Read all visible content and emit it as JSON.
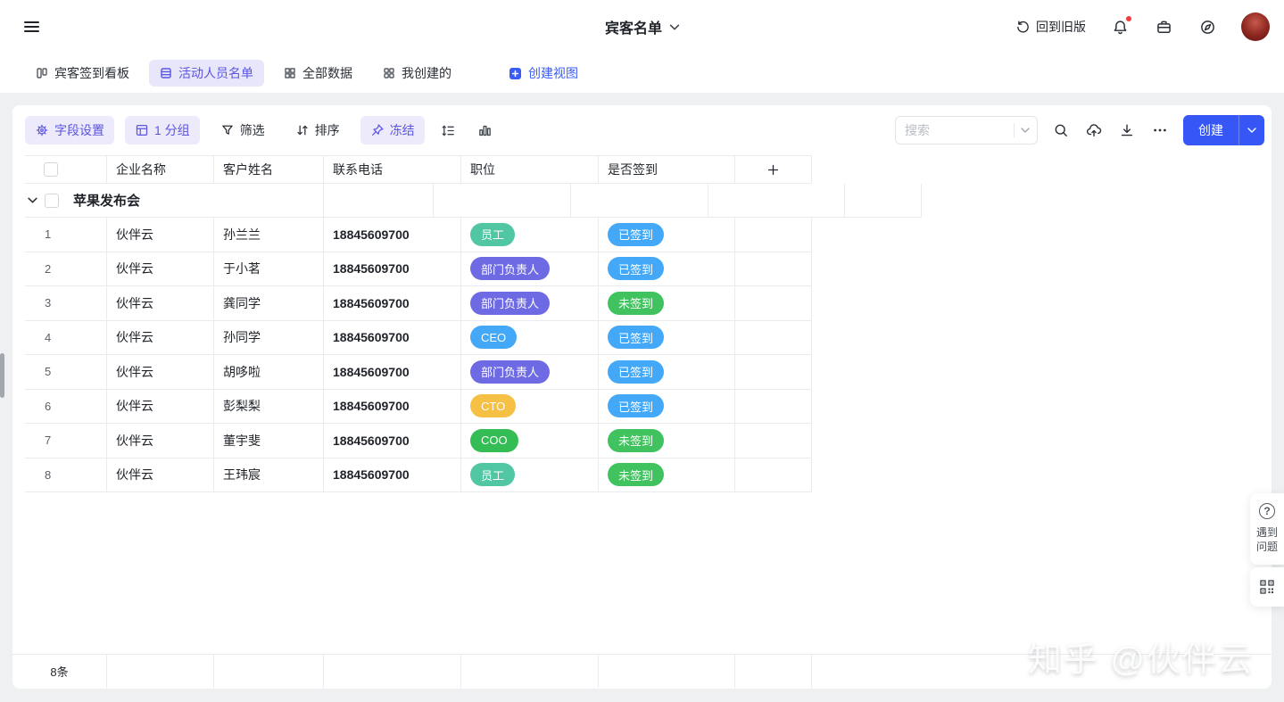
{
  "topbar": {
    "title": "宾客名单",
    "back_old": "回到旧版"
  },
  "tabs": {
    "items": [
      {
        "label": "宾客签到看板"
      },
      {
        "label": "活动人员名单"
      },
      {
        "label": "全部数据"
      },
      {
        "label": "我创建的"
      }
    ],
    "create_view": "创建视图"
  },
  "toolbar": {
    "field_settings": "字段设置",
    "group": "1 分组",
    "filter": "筛选",
    "sort": "排序",
    "freeze": "冻结",
    "search_placeholder": "搜索",
    "create": "创建"
  },
  "table": {
    "columns": [
      "企业名称",
      "客户姓名",
      "联系电话",
      "职位",
      "是否签到"
    ],
    "group_name": "苹果发布会",
    "rows": [
      {
        "num": "1",
        "company": "伙伴云",
        "name": "孙兰兰",
        "phone": "18845609700",
        "position": "员工",
        "position_color": "teal",
        "signin": "已签到",
        "signin_color": "blue"
      },
      {
        "num": "2",
        "company": "伙伴云",
        "name": "于小茗",
        "phone": "18845609700",
        "position": "部门负责人",
        "position_color": "purple",
        "signin": "已签到",
        "signin_color": "blue"
      },
      {
        "num": "3",
        "company": "伙伴云",
        "name": "龚同学",
        "phone": "18845609700",
        "position": "部门负责人",
        "position_color": "purple",
        "signin": "未签到",
        "signin_color": "green2"
      },
      {
        "num": "4",
        "company": "伙伴云",
        "name": "孙同学",
        "phone": "18845609700",
        "position": "CEO",
        "position_color": "blue",
        "signin": "已签到",
        "signin_color": "blue"
      },
      {
        "num": "5",
        "company": "伙伴云",
        "name": "胡哆啦",
        "phone": "18845609700",
        "position": "部门负责人",
        "position_color": "purple",
        "signin": "已签到",
        "signin_color": "blue"
      },
      {
        "num": "6",
        "company": "伙伴云",
        "name": "彭梨梨",
        "phone": "18845609700",
        "position": "CTO",
        "position_color": "yellow",
        "signin": "已签到",
        "signin_color": "blue"
      },
      {
        "num": "7",
        "company": "伙伴云",
        "name": "董宇斐",
        "phone": "18845609700",
        "position": "COO",
        "position_color": "green",
        "signin": "未签到",
        "signin_color": "green2"
      },
      {
        "num": "8",
        "company": "伙伴云",
        "name": "王玮宸",
        "phone": "18845609700",
        "position": "员工",
        "position_color": "teal",
        "signin": "未签到",
        "signin_color": "green2"
      }
    ],
    "footer_count": "8条"
  },
  "help": {
    "label": "遇到问题"
  },
  "watermark": "知乎 @伙伴云",
  "colors": {
    "accent": "#5b55e0",
    "accent_bg": "#eceafb",
    "active_tab_bg": "#e8e6fa",
    "link_blue": "#3b5bf6",
    "create_button": "#3657f5",
    "pill_teal": "#50c7a2",
    "pill_purple": "#6e6ae3",
    "pill_blue": "#42a8f7",
    "pill_yellow": "#f5c044",
    "pill_green": "#34bd54",
    "pill_green_light": "#40c35e"
  }
}
